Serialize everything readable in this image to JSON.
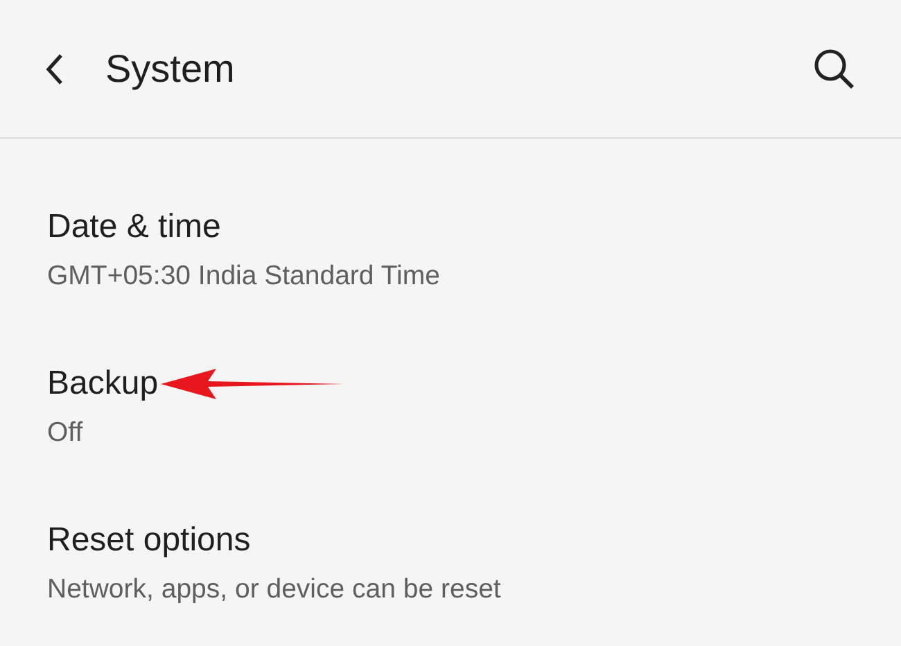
{
  "header": {
    "title": "System"
  },
  "settings": [
    {
      "title": "Date & time",
      "summary": "GMT+05:30 India Standard Time",
      "highlighted": false
    },
    {
      "title": "Backup",
      "summary": "Off",
      "highlighted": true
    },
    {
      "title": "Reset options",
      "summary": "Network, apps, or device can be reset",
      "highlighted": false
    }
  ]
}
